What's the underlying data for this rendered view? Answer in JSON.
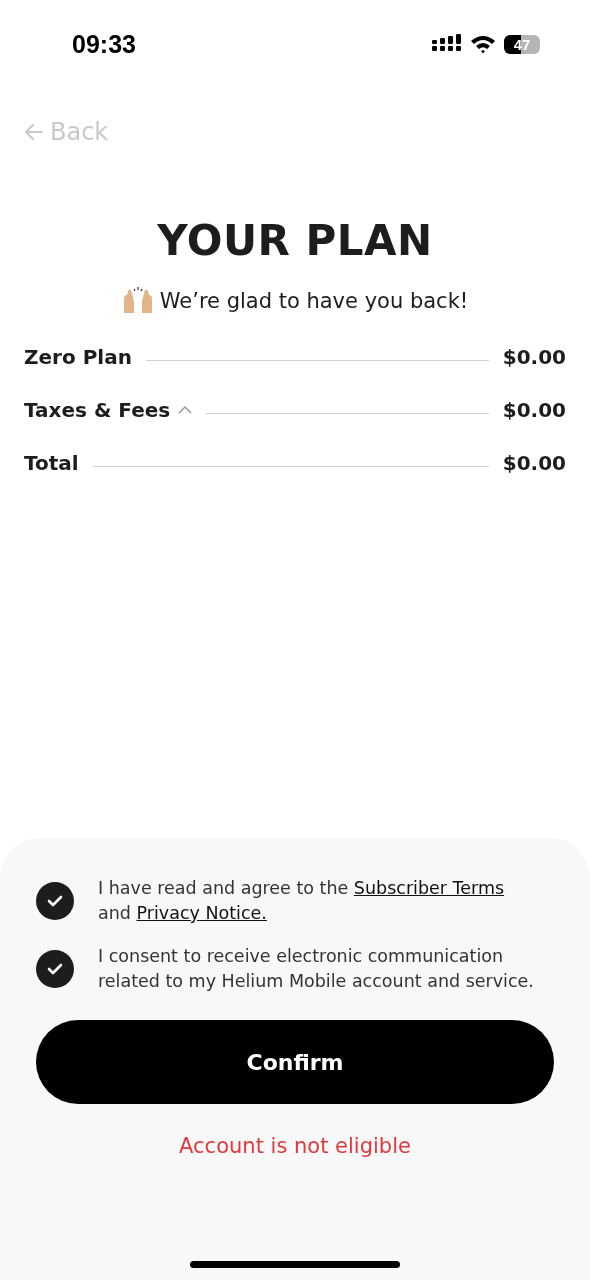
{
  "status_bar": {
    "time": "09:33",
    "battery": "47"
  },
  "back": {
    "label": "Back"
  },
  "title": "YOUR PLAN",
  "subtitle": "We’re glad to have you back!",
  "line_items": [
    {
      "kind": "plain",
      "label": "Zero Plan",
      "amount": "$0.00"
    },
    {
      "kind": "expandable",
      "label": "Taxes & Fees",
      "amount": "$0.00",
      "expanded": true
    },
    {
      "kind": "plain",
      "label": "Total",
      "amount": "$0.00"
    }
  ],
  "agreements": [
    {
      "checked": true,
      "segments": [
        {
          "kind": "text",
          "text": "I have read and agree to the "
        },
        {
          "kind": "link",
          "text": "Subscriber Terms"
        },
        {
          "kind": "text",
          "text": " and "
        },
        {
          "kind": "link",
          "text": "Privacy Notice."
        }
      ]
    },
    {
      "checked": true,
      "segments": [
        {
          "kind": "text",
          "text": "I consent to receive electronic communication related to my Helium Mobile account and service."
        }
      ]
    }
  ],
  "confirm_button": {
    "label": "Confirm"
  },
  "error": "Account is not eligible"
}
